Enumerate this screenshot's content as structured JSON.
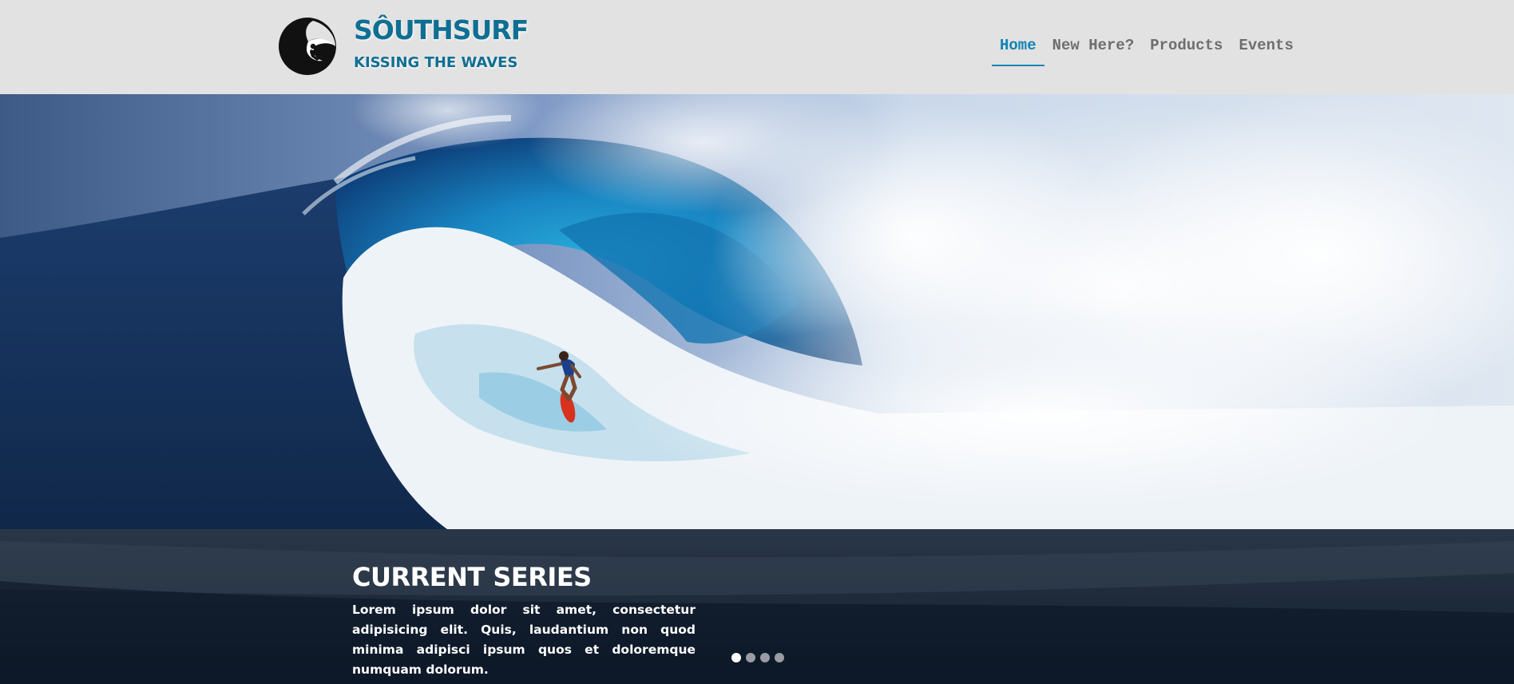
{
  "brand": {
    "name": "SÔUTHSURF",
    "tagline": "KISSING THE WAVES",
    "color": "#0f6f93"
  },
  "nav": {
    "items": [
      {
        "label": "Home",
        "active": true
      },
      {
        "label": "New Here?",
        "active": false
      },
      {
        "label": "Products",
        "active": false
      },
      {
        "label": "Events",
        "active": false
      }
    ],
    "active_color": "#1084b4"
  },
  "hero": {
    "image": "surfer-riding-large-wave",
    "caption": {
      "title": "CURRENT SERIES",
      "text": "Lorem ipsum dolor sit amet, consectetur adipisicing elit. Quis, laudantium non quod minima adipisci ipsum quos et doloremque numquam dolorum."
    },
    "slider": {
      "count": 4,
      "active_index": 0
    }
  }
}
